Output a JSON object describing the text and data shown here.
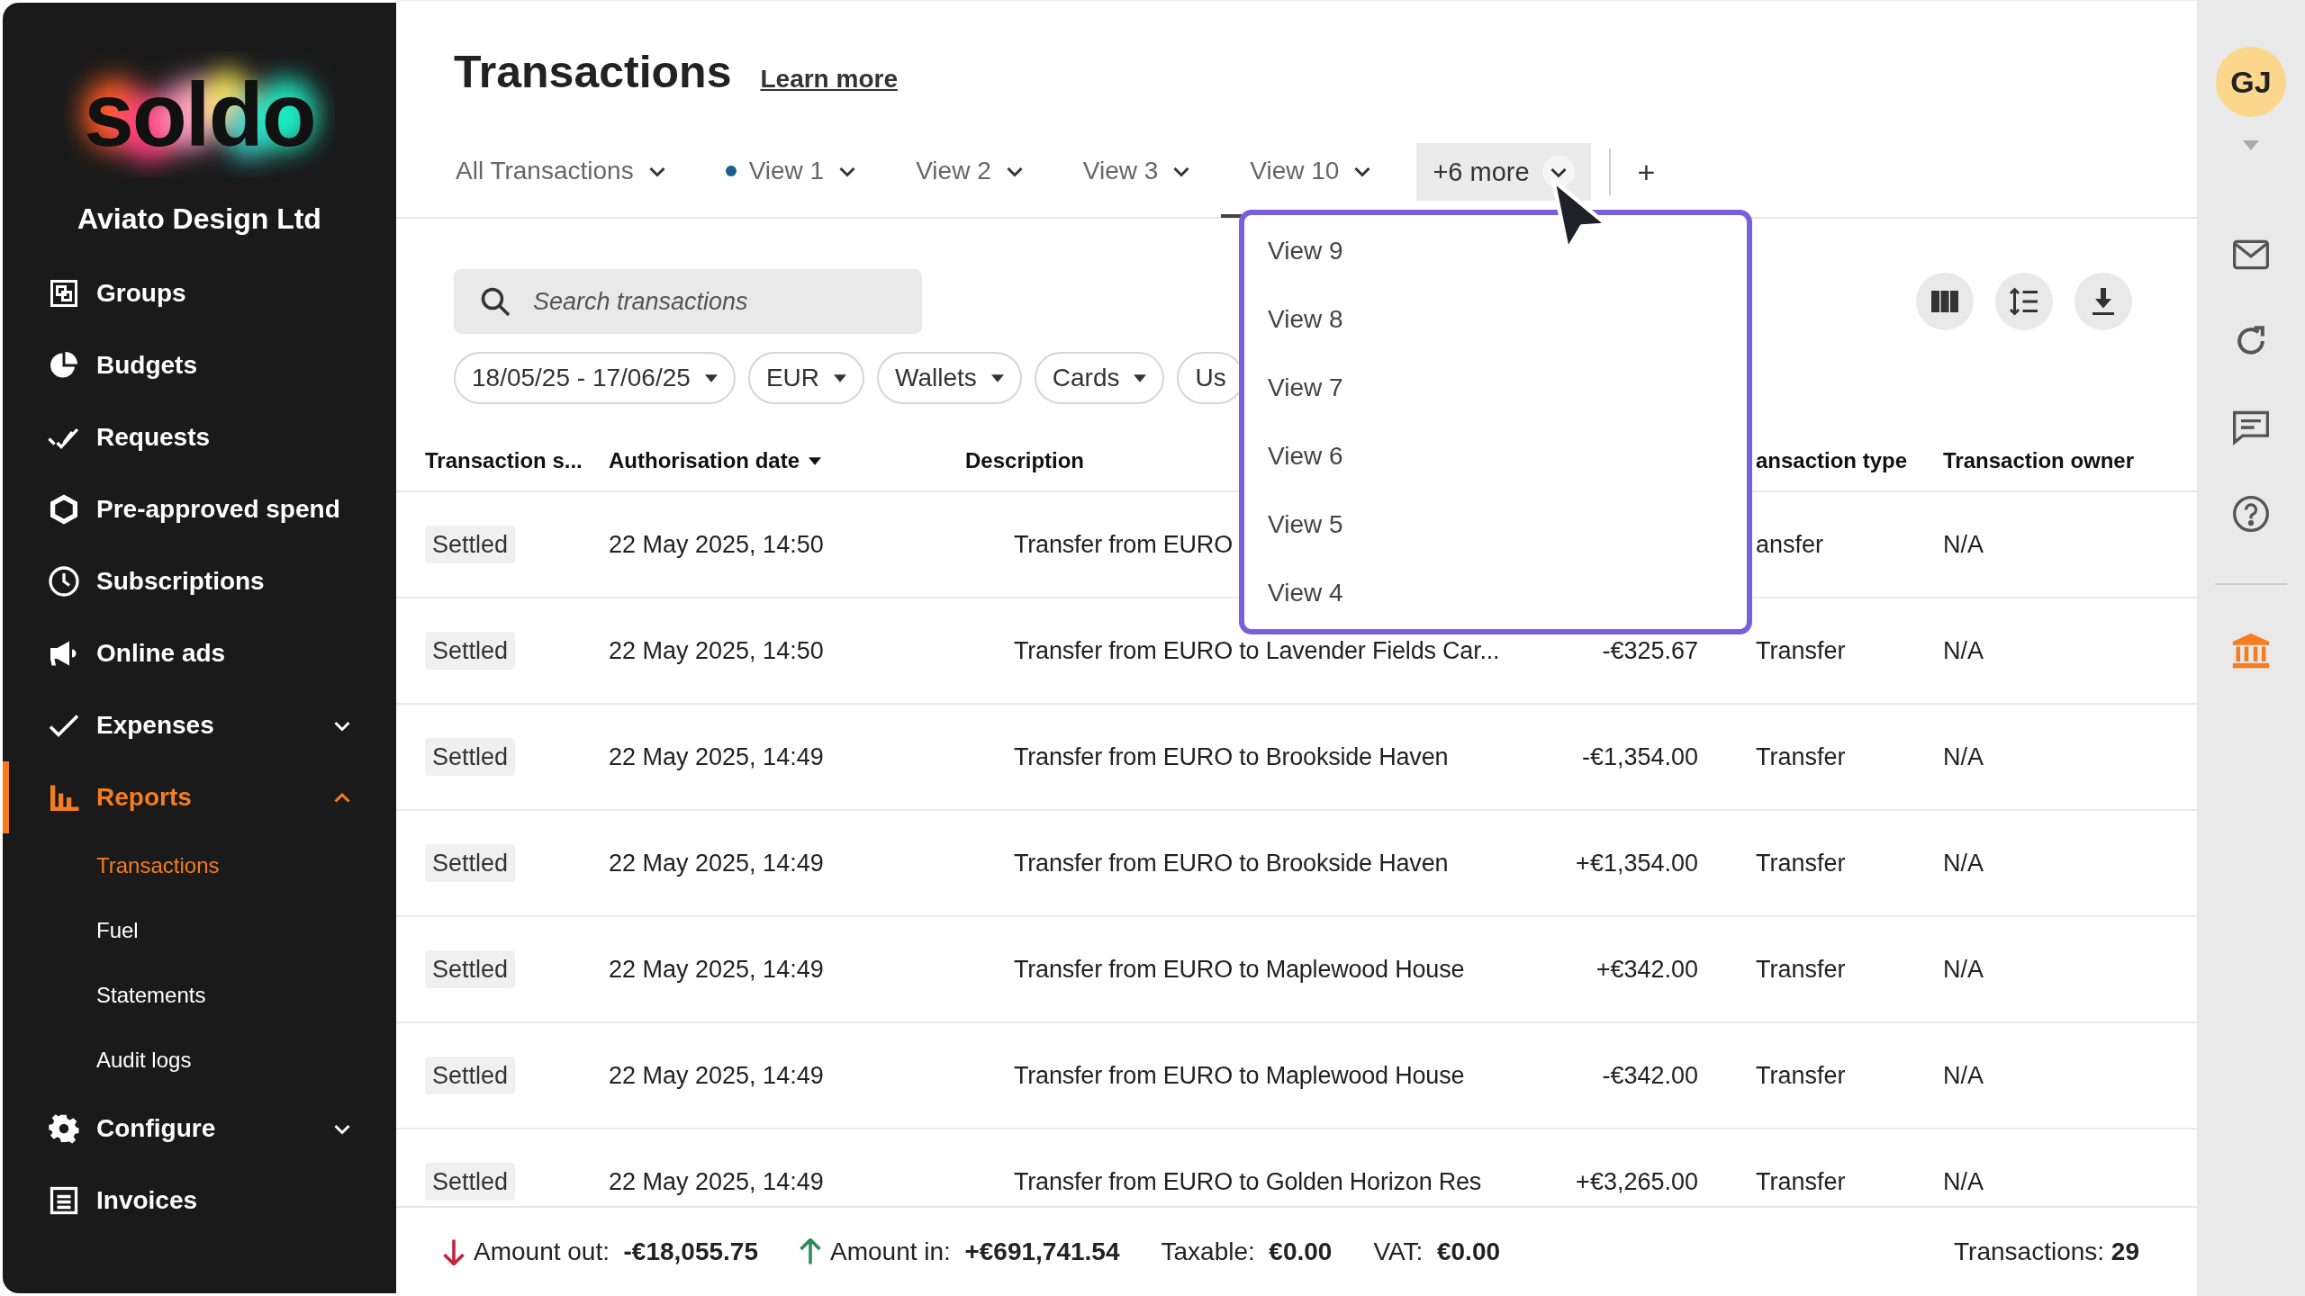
{
  "sidebar": {
    "logo": "soldo",
    "company": "Aviato Design Ltd",
    "items": [
      {
        "label": "Groups",
        "selected": false
      },
      {
        "label": "Budgets",
        "selected": false
      },
      {
        "label": "Requests",
        "selected": false
      },
      {
        "label": "Pre-approved spend",
        "selected": false
      },
      {
        "label": "Subscriptions",
        "selected": false
      },
      {
        "label": "Online ads",
        "selected": false
      },
      {
        "label": "Expenses",
        "selected": false,
        "expanded": false
      },
      {
        "label": "Reports",
        "selected": true,
        "expanded": true,
        "children": [
          {
            "label": "Transactions",
            "selected": true
          },
          {
            "label": "Fuel",
            "selected": false
          },
          {
            "label": "Statements",
            "selected": false
          },
          {
            "label": "Audit logs",
            "selected": false
          }
        ]
      },
      {
        "label": "Configure",
        "selected": false,
        "expanded": false
      },
      {
        "label": "Invoices",
        "selected": false
      }
    ]
  },
  "header": {
    "title": "Transactions",
    "link": "Learn more"
  },
  "tabs": [
    {
      "label": "All Transactions",
      "selected": false,
      "dot": false
    },
    {
      "label": "View 1",
      "selected": false,
      "dot": true
    },
    {
      "label": "View 2",
      "selected": false,
      "dot": false
    },
    {
      "label": "View 3",
      "selected": false,
      "dot": false
    },
    {
      "label": "View 10",
      "selected": true,
      "dot": false
    }
  ],
  "more_button": {
    "label": "+6 more",
    "expanded": true
  },
  "add_button": "+",
  "dropdown": {
    "items": [
      {
        "label": "View 9"
      },
      {
        "label": "View 8"
      },
      {
        "label": "View 7"
      },
      {
        "label": "View 6"
      },
      {
        "label": "View 5"
      },
      {
        "label": "View 4"
      }
    ]
  },
  "search": {
    "placeholder": "Search transactions"
  },
  "filters": [
    "18/05/25 - 17/06/25",
    "EUR",
    "Wallets",
    "Cards",
    "Us"
  ],
  "table": {
    "columns": [
      {
        "label": "Transaction s...",
        "sorted": false
      },
      {
        "label": "Authorisation date",
        "sorted": true
      },
      {
        "label": "Description",
        "sorted": false
      },
      {
        "label": "ansaction type",
        "sorted": false
      },
      {
        "label": "Transaction owner",
        "sorted": false
      }
    ],
    "rows": [
      {
        "status": "Settled",
        "date": "22 May 2025, 14:50",
        "description": "Transfer from EURO",
        "type": "ansfer",
        "owner": "N/A"
      },
      {
        "status": "Settled",
        "date": "22 May 2025, 14:50",
        "description": "Transfer from EURO to Lavender Fields Car...",
        "amount": "-€325.67",
        "type": "Transfer",
        "owner": "N/A"
      },
      {
        "status": "Settled",
        "date": "22 May 2025, 14:49",
        "description": "Transfer from EURO to Brookside Haven",
        "amount": "-€1,354.00",
        "type": "Transfer",
        "owner": "N/A"
      },
      {
        "status": "Settled",
        "date": "22 May 2025, 14:49",
        "description": "Transfer from EURO to Brookside Haven",
        "amount": "+€1,354.00",
        "type": "Transfer",
        "owner": "N/A"
      },
      {
        "status": "Settled",
        "date": "22 May 2025, 14:49",
        "description": "Transfer from EURO to Maplewood House",
        "amount": "+€342.00",
        "type": "Transfer",
        "owner": "N/A"
      },
      {
        "status": "Settled",
        "date": "22 May 2025, 14:49",
        "description": "Transfer from EURO to Maplewood House",
        "amount": "-€342.00",
        "type": "Transfer",
        "owner": "N/A"
      },
      {
        "status": "Settled",
        "date": "22 May 2025, 14:49",
        "description": "Transfer from EURO to Golden Horizon Res",
        "amount": "+€3,265.00",
        "type": "Transfer",
        "owner": "N/A"
      }
    ]
  },
  "footer": {
    "items": [
      {
        "kind": "out",
        "text": "Amount out:  **-€18,055.75**"
      },
      {
        "kind": "in",
        "text": "Amount in:  **+€691,741.54**"
      },
      {
        "kind": "plain",
        "text": "Taxable:  **€0.00**"
      },
      {
        "kind": "plain",
        "text": "VAT:  **€0.00**"
      }
    ],
    "count": "Transactions: **29**"
  },
  "rail": {
    "avatar": "GJ"
  }
}
